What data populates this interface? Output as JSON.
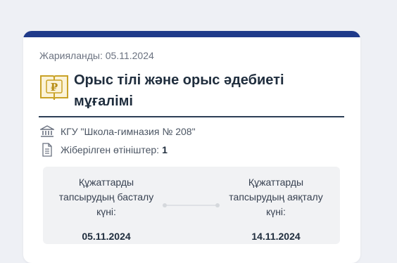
{
  "published": "Жарияланды: 05.11.2024",
  "title_line1": "Орыс тілі және орыс әдебиеті",
  "title_line2": "мұғалімі",
  "organization": "КГУ \"Школа-гимназия № 208\"",
  "applications_label": "Жіберілген өтініштер:",
  "applications_count": "1",
  "start": {
    "label_line1": "Құжаттарды",
    "label_line2": "тапсырудың басталу",
    "label_line3": "күні:",
    "value": "05.11.2024"
  },
  "end": {
    "label_line1": "Құжаттарды",
    "label_line2": "тапсырудың аяқталу",
    "label_line3": "күні:",
    "value": "14.11.2024"
  },
  "colors": {
    "accent": "#1f3a8a",
    "title": "#1f2d3d",
    "muted": "#6b7280",
    "icon_gold": "#c9a227"
  },
  "icons": {
    "subject": "book-ruble-icon",
    "org": "institution-icon",
    "apps": "document-icon"
  }
}
